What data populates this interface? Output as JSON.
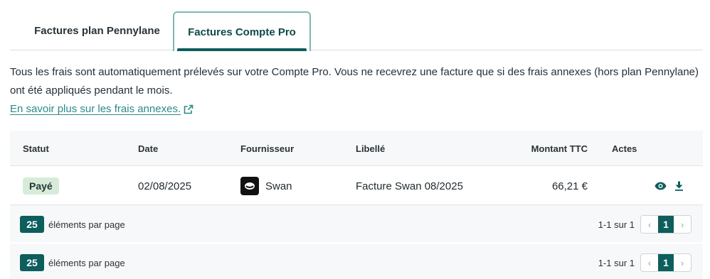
{
  "tabs": [
    {
      "label": "Factures plan Pennylane",
      "active": false
    },
    {
      "label": "Factures Compte Pro",
      "active": true
    }
  ],
  "intro": {
    "text": "Tous les frais sont automatiquement prélevés sur votre Compte Pro. Vous ne recevrez une facture que si des frais annexes (hors plan Pennylane) ont été appliqués pendant le mois.",
    "link_label": "En savoir plus sur les frais annexes."
  },
  "table": {
    "columns": [
      "Statut",
      "Date",
      "Fournisseur",
      "Libellé",
      "Montant TTC",
      "Actes"
    ],
    "rows": [
      {
        "status": "Payé",
        "date": "02/08/2025",
        "supplier": "Swan",
        "label": "Facture Swan 08/2025",
        "amount": "66,21 €"
      }
    ]
  },
  "pagination": [
    {
      "per_page": "25",
      "per_page_label": "éléments par page",
      "range": "1-1 sur 1",
      "current_page": "1"
    },
    {
      "per_page": "25",
      "per_page_label": "éléments par page",
      "range": "1-1 sur 1",
      "current_page": "1"
    }
  ],
  "icons": {
    "external_link": "external-link-icon",
    "view": "eye-icon",
    "download": "download-icon",
    "prev": "chevron-left-icon",
    "next": "chevron-right-icon",
    "supplier_logo": "swan-logo"
  },
  "colors": {
    "accent": "#0d5e5c",
    "link": "#2b8b86",
    "paid_badge_bg": "#d6ecd9",
    "tab_border": "#7fb8b2"
  }
}
